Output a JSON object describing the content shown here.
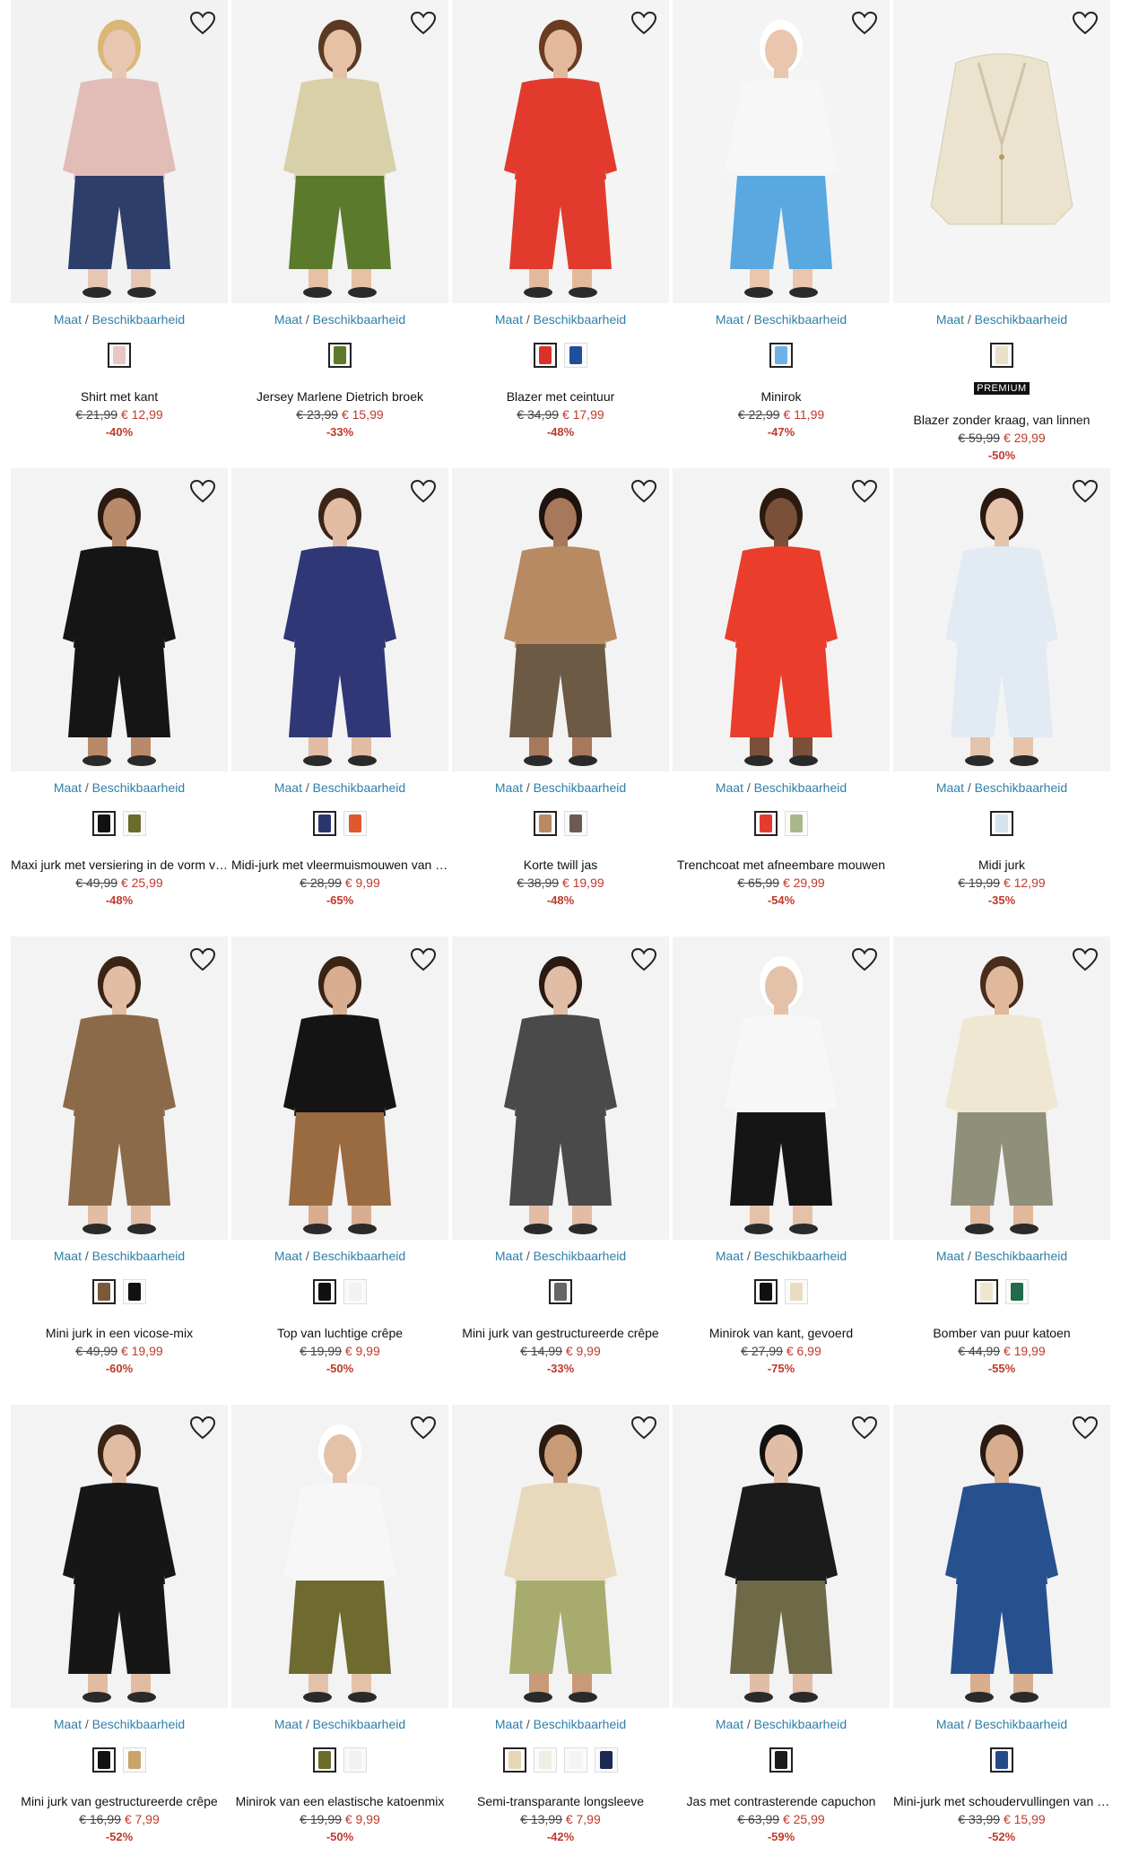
{
  "availability_label": "Maat / Beschikbaarheid",
  "availability_parts": [
    "Maat",
    "/",
    "Beschikbaarheid"
  ],
  "wishlist_icon": "heart-outline-icon",
  "colors": {
    "link": "#2e7fa8",
    "sale": "#c0392b",
    "premium_bg": "#111111"
  },
  "products": [
    {
      "name": "Shirt met kant",
      "old_price": "€ 21,99",
      "new_price": "€ 12,99",
      "discount": "-40%",
      "swatches": [
        "#e7c6c4"
      ],
      "premium": false,
      "art": {
        "bg": "#f2f2f2",
        "top": "#e2bdb8",
        "bottom": "#2d3e6a",
        "skin": "#e8c7b2",
        "hair": "#d9b777"
      }
    },
    {
      "name": "Jersey Marlene Dietrich broek",
      "old_price": "€ 23,99",
      "new_price": "€ 15,99",
      "discount": "-33%",
      "swatches": [
        "#5b7a2c"
      ],
      "premium": false,
      "art": {
        "bg": "#f3f3f3",
        "top": "#d8d0a8",
        "bottom": "#5b7a2c",
        "skin": "#e6c1a6",
        "hair": "#5a3a24"
      }
    },
    {
      "name": "Blazer met ceintuur",
      "old_price": "€ 34,99",
      "new_price": "€ 17,99",
      "discount": "-48%",
      "swatches": [
        "#d9322b",
        "#1d4f9a"
      ],
      "premium": false,
      "art": {
        "bg": "#f4f4f4",
        "top": "#e23b2e",
        "bottom": "#e23b2e",
        "skin": "#e3b99c",
        "hair": "#6b3b22"
      }
    },
    {
      "name": "Minirok",
      "old_price": "€ 22,99",
      "new_price": "€ 11,99",
      "discount": "-47%",
      "swatches": [
        "#6fb1e6"
      ],
      "premium": false,
      "art": {
        "bg": "#f4f4f4",
        "top": "#f7f7f7",
        "bottom": "#5aa8e0",
        "skin": "#e9c6ad",
        "hair": "#ffffff"
      }
    },
    {
      "name": "Blazer zonder kraag, van linnen",
      "old_price": "€ 59,99",
      "new_price": "€ 29,99",
      "discount": "-50%",
      "swatches": [
        "#eadfcb"
      ],
      "premium": true,
      "premium_label": "PREMIUM",
      "art": {
        "bg": "#f5f5f5",
        "top": "#ece3cf",
        "bottom": "#ece3cf",
        "skin": "#f5f5f5",
        "hair": "#f5f5f5"
      }
    },
    {
      "name": "Maxi jurk met versiering in de vorm van studs",
      "old_price": "€ 49,99",
      "new_price": "€ 25,99",
      "discount": "-48%",
      "swatches": [
        "#111111",
        "#6b6b2c"
      ],
      "premium": false,
      "art": {
        "bg": "#f3f3f3",
        "top": "#151515",
        "bottom": "#151515",
        "skin": "#b98a6a",
        "hair": "#2a1a12"
      }
    },
    {
      "name": "Midi-jurk met vleermuismouwen van satijn",
      "old_price": "€ 28,99",
      "new_price": "€ 9,99",
      "discount": "-65%",
      "swatches": [
        "#2c3570",
        "#e0572e"
      ],
      "premium": false,
      "art": {
        "bg": "#f3f3f3",
        "top": "#2f3776",
        "bottom": "#2f3776",
        "skin": "#e2bca3",
        "hair": "#3b2518"
      }
    },
    {
      "name": "Korte twill jas",
      "old_price": "€ 38,99",
      "new_price": "€ 19,99",
      "discount": "-48%",
      "swatches": [
        "#b98a63",
        "#6a5a52"
      ],
      "premium": false,
      "art": {
        "bg": "#f3f3f3",
        "top": "#b88a62",
        "bottom": "#6d5a45",
        "skin": "#a7785c",
        "hair": "#1e130d"
      }
    },
    {
      "name": "Trenchcoat met afneembare mouwen",
      "old_price": "€ 65,99",
      "new_price": "€ 29,99",
      "discount": "-54%",
      "swatches": [
        "#e53b2e",
        "#a8b88a"
      ],
      "premium": false,
      "art": {
        "bg": "#f3f3f3",
        "top": "#ea3d2c",
        "bottom": "#ea3d2c",
        "skin": "#7a5038",
        "hair": "#2a1a10"
      }
    },
    {
      "name": "Midi jurk",
      "old_price": "€ 19,99",
      "new_price": "€ 12,99",
      "discount": "-35%",
      "swatches": [
        "#d6e2ee"
      ],
      "premium": false,
      "art": {
        "bg": "#f3f3f3",
        "top": "#e2ebf4",
        "bottom": "#e2ebf4",
        "skin": "#e6c3ab",
        "hair": "#2a1a12"
      }
    },
    {
      "name": "Mini jurk in een vicose-mix",
      "old_price": "€ 49,99",
      "new_price": "€ 19,99",
      "discount": "-60%",
      "swatches": [
        "#7a5a3a",
        "#111111"
      ],
      "premium": false,
      "art": {
        "bg": "#f3f3f3",
        "top": "#8a6a48",
        "bottom": "#8a6a48",
        "skin": "#e3bda3",
        "hair": "#3a2416"
      }
    },
    {
      "name": "Top van luchtige crêpe",
      "old_price": "€ 19,99",
      "new_price": "€ 9,99",
      "discount": "-50%",
      "swatches": [
        "#111111",
        "#f2f2f2"
      ],
      "premium": false,
      "art": {
        "bg": "#f3f3f3",
        "top": "#141414",
        "bottom": "#9a6a40",
        "skin": "#d9ae90",
        "hair": "#3a2416"
      }
    },
    {
      "name": "Mini jurk van gestructureerde crêpe",
      "old_price": "€ 14,99",
      "new_price": "€ 9,99",
      "discount": "-33%",
      "swatches": [
        "#666666"
      ],
      "premium": false,
      "art": {
        "bg": "#f3f3f3",
        "top": "#4a4a4a",
        "bottom": "#4a4a4a",
        "skin": "#e2bda5",
        "hair": "#2a1a12"
      }
    },
    {
      "name": "Minirok van kant, gevoerd",
      "old_price": "€ 27,99",
      "new_price": "€ 6,99",
      "discount": "-75%",
      "swatches": [
        "#111111",
        "#eadcc3"
      ],
      "premium": false,
      "art": {
        "bg": "#f3f3f3",
        "top": "#f7f7f7",
        "bottom": "#151515",
        "skin": "#e4c2aa",
        "hair": "#ffffff"
      }
    },
    {
      "name": "Bomber van puur katoen",
      "old_price": "€ 44,99",
      "new_price": "€ 19,99",
      "discount": "-55%",
      "swatches": [
        "#efe6cf",
        "#1f6b4a"
      ],
      "premium": false,
      "art": {
        "bg": "#f3f3f3",
        "top": "#efe7d2",
        "bottom": "#8f8f7a",
        "skin": "#e0b89c",
        "hair": "#4a2c1a"
      }
    },
    {
      "name": "Mini jurk van gestructureerde crêpe",
      "old_price": "€ 16,99",
      "new_price": "€ 7,99",
      "discount": "-52%",
      "swatches": [
        "#111111",
        "#c8a46a"
      ],
      "premium": false,
      "art": {
        "bg": "#f3f3f3",
        "top": "#161616",
        "bottom": "#161616",
        "skin": "#e1bca3",
        "hair": "#3a2416"
      }
    },
    {
      "name": "Minirok van een elastische katoenmix",
      "old_price": "€ 19,99",
      "new_price": "€ 9,99",
      "discount": "-50%",
      "swatches": [
        "#6b6b2c",
        "#f2f2f2"
      ],
      "premium": false,
      "art": {
        "bg": "#f3f3f3",
        "top": "#f7f7f7",
        "bottom": "#6e6a30",
        "skin": "#e4c2aa",
        "hair": "#ffffff"
      }
    },
    {
      "name": "Semi-transparante longsleeve",
      "old_price": "€ 13,99",
      "new_price": "€ 7,99",
      "discount": "-42%",
      "swatches": [
        "#e6d6b8",
        "#eeeee4",
        "#f4f4f4",
        "#1d2a52"
      ],
      "premium": false,
      "art": {
        "bg": "#f3f3f3",
        "top": "#e8d9bc",
        "bottom": "#a8ab6e",
        "skin": "#c99a78",
        "hair": "#2a1a12"
      }
    },
    {
      "name": "Jas met contrasterende capuchon",
      "old_price": "€ 63,99",
      "new_price": "€ 25,99",
      "discount": "-59%",
      "swatches": [
        "#1a1a1a"
      ],
      "premium": false,
      "art": {
        "bg": "#f3f3f3",
        "top": "#1b1b1b",
        "bottom": "#6e6a48",
        "skin": "#e2bda5",
        "hair": "#111111"
      }
    },
    {
      "name": "Mini-jurk met schoudervullingen van gestructureerd materiaal",
      "old_price": "€ 33,99",
      "new_price": "€ 15,99",
      "discount": "-52%",
      "swatches": [
        "#244a8a"
      ],
      "premium": false,
      "art": {
        "bg": "#f3f3f3",
        "top": "#27508f",
        "bottom": "#27508f",
        "skin": "#d8ae8e",
        "hair": "#2a1a12"
      }
    }
  ]
}
